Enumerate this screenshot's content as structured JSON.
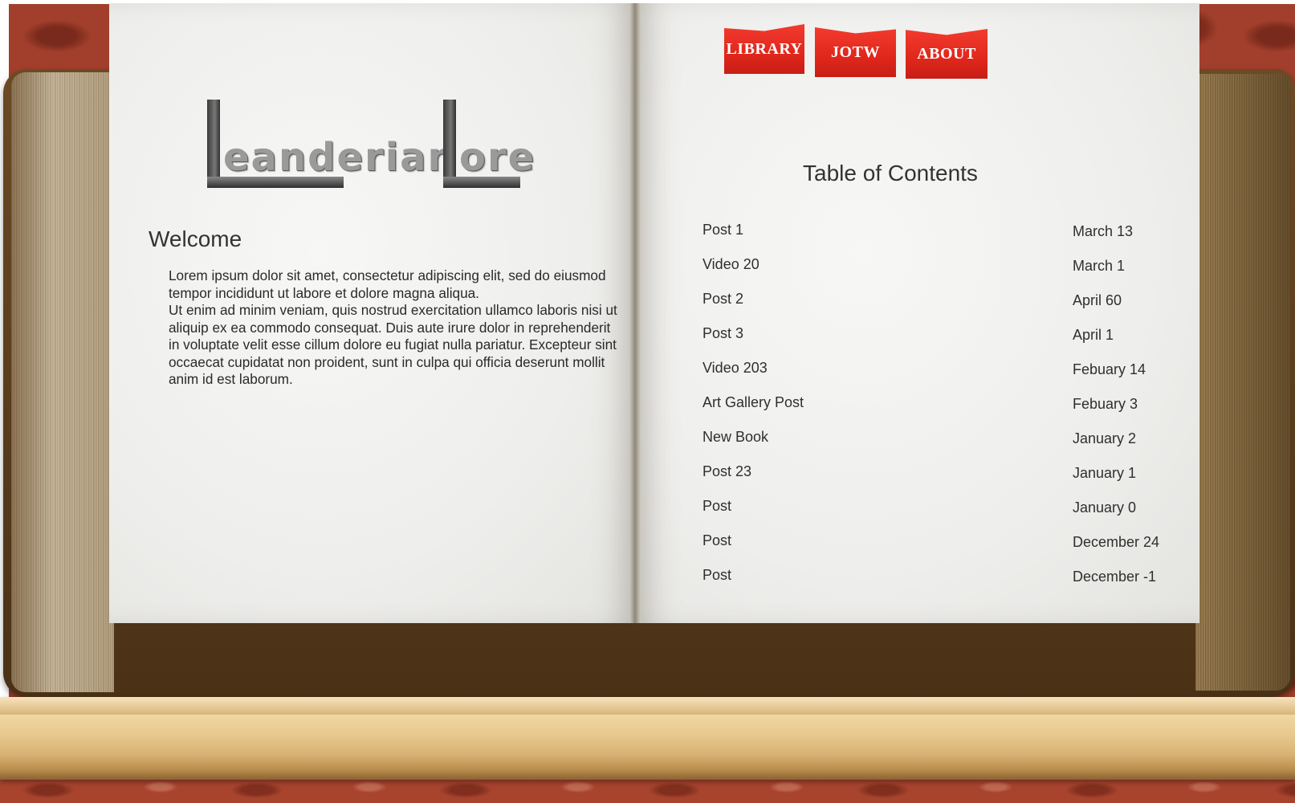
{
  "nav": {
    "tabs": [
      {
        "label": "LIBRARY"
      },
      {
        "label": "JOTW"
      },
      {
        "label": "ABOUT"
      }
    ],
    "tab_color": "#e0271c"
  },
  "logo": {
    "text": "LeanderianLore",
    "part1": "eanderian",
    "part2": "ore"
  },
  "welcome": {
    "title": "Welcome",
    "paragraph1": "Lorem ipsum dolor sit amet, consectetur adipiscing elit, sed do eiusmod tempor incididunt ut labore et dolore magna aliqua.",
    "paragraph2": "Ut enim ad minim veniam, quis nostrud exercitation ullamco laboris nisi ut aliquip ex ea commodo consequat. Duis aute irure dolor in reprehenderit in voluptate velit esse cillum dolore eu fugiat nulla pariatur. Excepteur sint occaecat cupidatat non proident, sunt in culpa qui officia deserunt mollit anim id est laborum."
  },
  "toc": {
    "title": "Table of Contents",
    "entries": [
      {
        "name": "Post 1",
        "date": "March 13"
      },
      {
        "name": "Video 20",
        "date": "March 1"
      },
      {
        "name": "Post 2",
        "date": "April 60"
      },
      {
        "name": "Post 3",
        "date": "April 1"
      },
      {
        "name": "Video 203",
        "date": "Febuary 14"
      },
      {
        "name": "Art Gallery Post",
        "date": "Febuary 3"
      },
      {
        "name": "New Book",
        "date": "January 2"
      },
      {
        "name": "Post 23",
        "date": "January 1"
      },
      {
        "name": "Post",
        "date": "January 0"
      },
      {
        "name": "Post",
        "date": "December 24"
      },
      {
        "name": "Post",
        "date": "December -1"
      }
    ]
  }
}
